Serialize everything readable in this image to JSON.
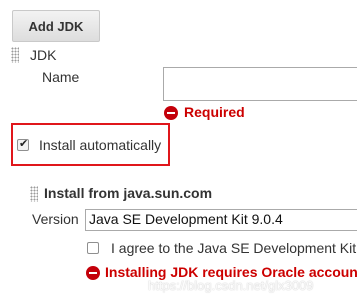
{
  "add_jdk_button": "Add JDK",
  "jdk": {
    "title": "JDK",
    "name_label": "Name",
    "name_value": "",
    "required_error": "Required",
    "install_automatically_label": "Install automatically",
    "install_automatically_checked": true
  },
  "installer": {
    "title": "Install from java.sun.com",
    "version_label": "Version",
    "version_value": "Java SE Development Kit 9.0.4",
    "agree_label": "I agree to the Java SE Development Kit",
    "agree_checked": false,
    "oracle_error": "Installing JDK requires Oracle accoun"
  },
  "watermark": "https://blog.csdn.net/glx3009",
  "colors": {
    "error": "#cc0000",
    "highlight_border": "#e0161b",
    "button_bg": "#e6e6e6"
  },
  "icons": [
    "drag-handle-icon",
    "error-icon",
    "checkbox-checked-icon",
    "checkbox-empty-icon"
  ]
}
